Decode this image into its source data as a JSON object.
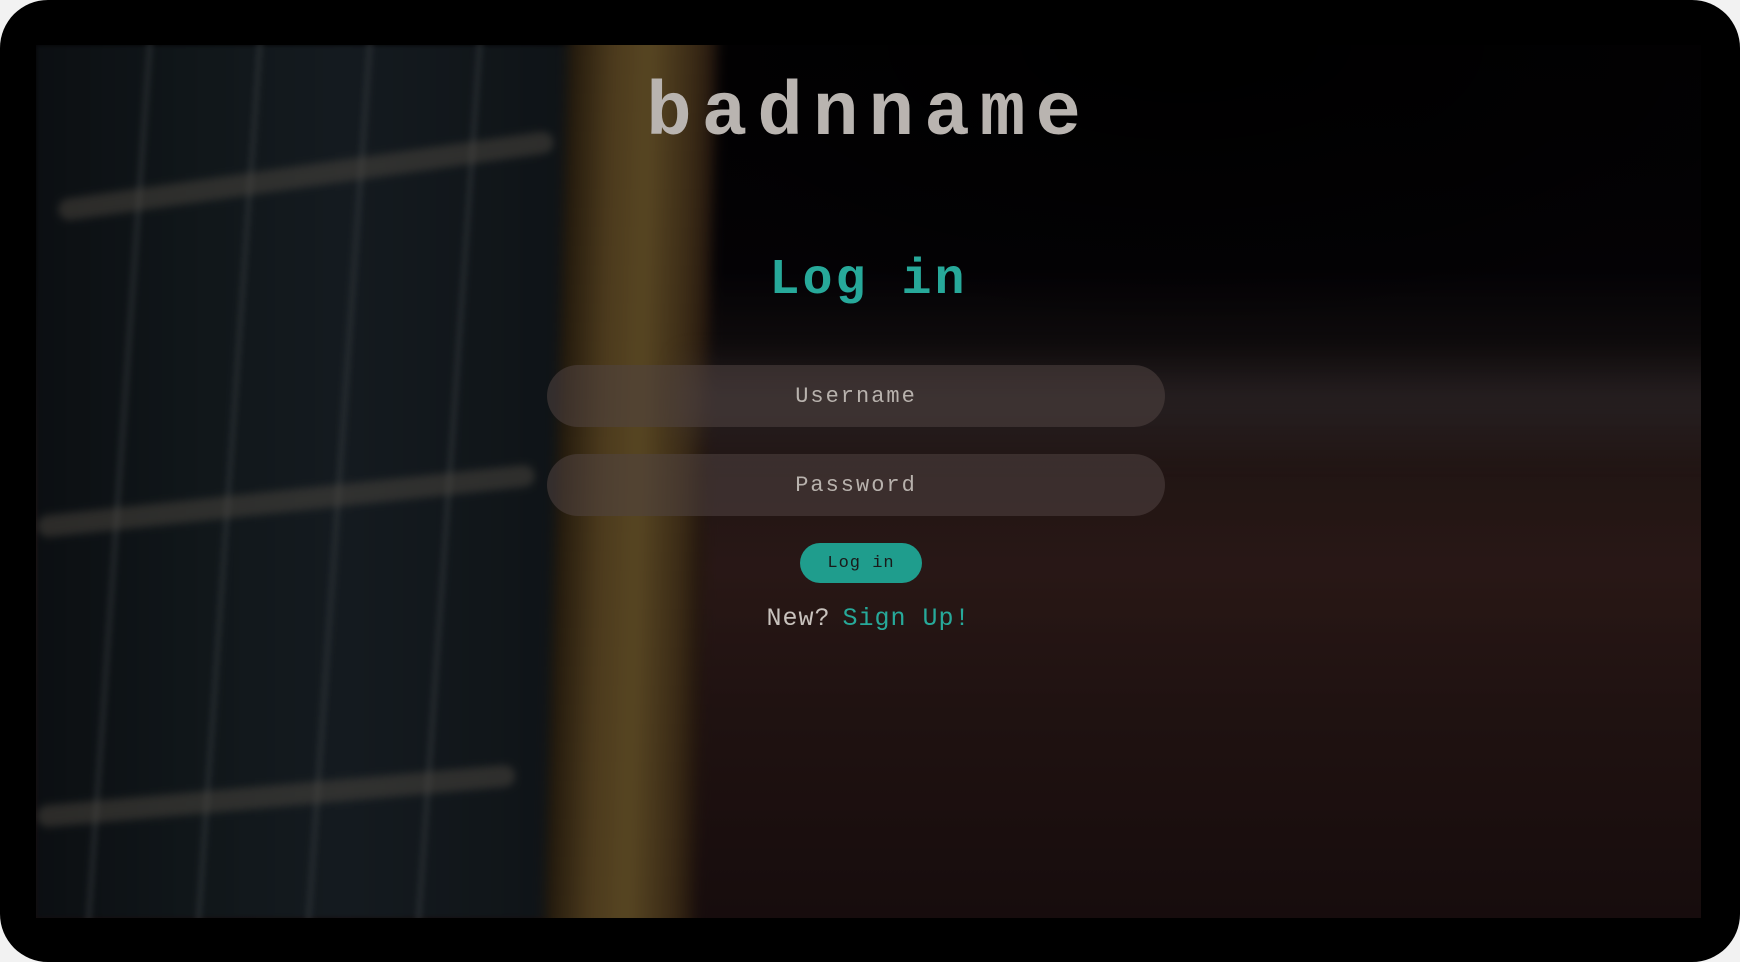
{
  "app": {
    "brand": "badnname"
  },
  "login": {
    "heading": "Log in",
    "username_placeholder": "Username",
    "password_placeholder": "Password",
    "submit_label": "Log in",
    "signup_prompt": "New?",
    "signup_link": "Sign Up!"
  },
  "colors": {
    "accent": "#27a99a",
    "button_bg": "#1f9d8d",
    "brand_text": "#b9b4b0",
    "field_bg": "rgba(80,68,66,0.55)",
    "frame": "#000000"
  }
}
